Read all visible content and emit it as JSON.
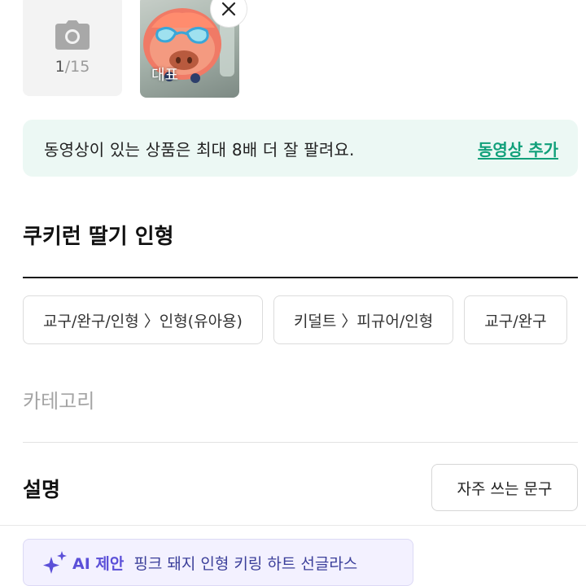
{
  "photos": {
    "count_current": "1",
    "count_max": "/15",
    "representative_badge": "대표"
  },
  "notice": {
    "text": "동영상이 있는 상품은 최대 8배 더 잘 팔려요.",
    "link": "동영상 추가"
  },
  "title": {
    "value": "쿠키런 딸기 인형"
  },
  "category_suggestions": [
    "교구/완구/인형 〉인형(유아용)",
    "키덜트 〉피규어/인형",
    "교구/완구"
  ],
  "category": {
    "placeholder": "카테고리"
  },
  "description": {
    "label": "설명",
    "phrase_button": "자주 쓰는 문구"
  },
  "ai": {
    "label": "AI 제안",
    "suggestion": "핑크 돼지 인형 키링 하트 선글라스"
  },
  "colors": {
    "accent_green": "#11a07a",
    "notice_bg": "#ecf8f4",
    "ai_purple": "#5b4fd8"
  }
}
